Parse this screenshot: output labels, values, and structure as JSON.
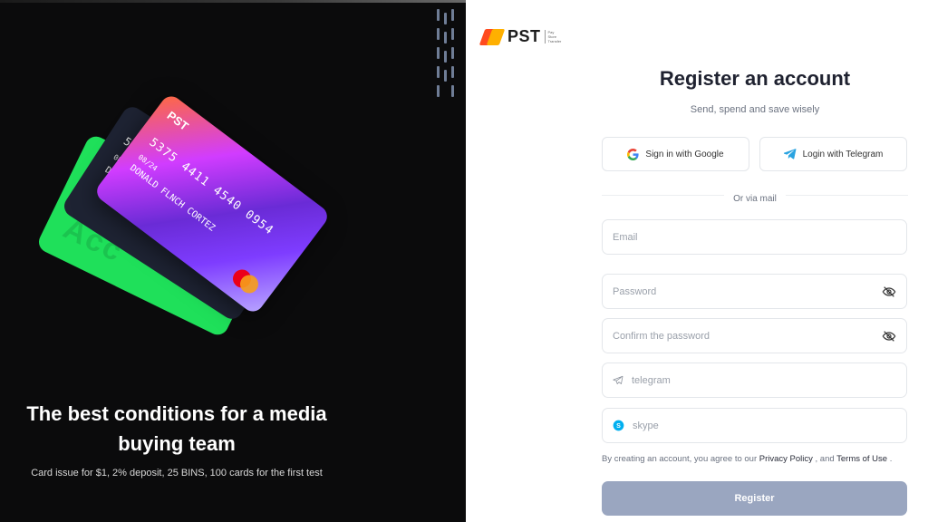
{
  "left": {
    "headline_line1": "The best conditions for a media",
    "headline_line2": "buying team",
    "subline": "Card issue for $1, 2% deposit, 25 BINS, 100 cards for the first test",
    "cards": {
      "logo": "PST",
      "number": "5375 4411 4540 0954",
      "expiry": "08/24",
      "holder": "DONALD FLNCH CORTEZ",
      "back_number": "537",
      "green_ghost": "Acc"
    }
  },
  "logo": {
    "text": "PST",
    "sub1": "Pay",
    "sub2": "Store",
    "sub3": "Transfer"
  },
  "form": {
    "title": "Register an account",
    "subtitle": "Send, spend and save wisely",
    "google_label": "Sign in with Google",
    "telegram_label": "Login with Telegram",
    "divider": "Or via mail",
    "email_placeholder": "Email",
    "password_placeholder": "Password",
    "confirm_placeholder": "Confirm the password",
    "telegram_placeholder": "telegram",
    "skype_placeholder": "skype",
    "terms_prefix": "By creating an account, you agree to our",
    "privacy_link": "Privacy Policy",
    "terms_mid": ", and",
    "terms_link": "Terms of Use",
    "terms_suffix": ".",
    "register_label": "Register"
  },
  "colors": {
    "left_bg": "#0b0b0c",
    "register_bg": "#9aa6c0",
    "green_card": "#1fe05a",
    "telegram_blue": "#2aa3e0",
    "skype_blue": "#00aff0",
    "brand_orange": "#ff6a00"
  }
}
